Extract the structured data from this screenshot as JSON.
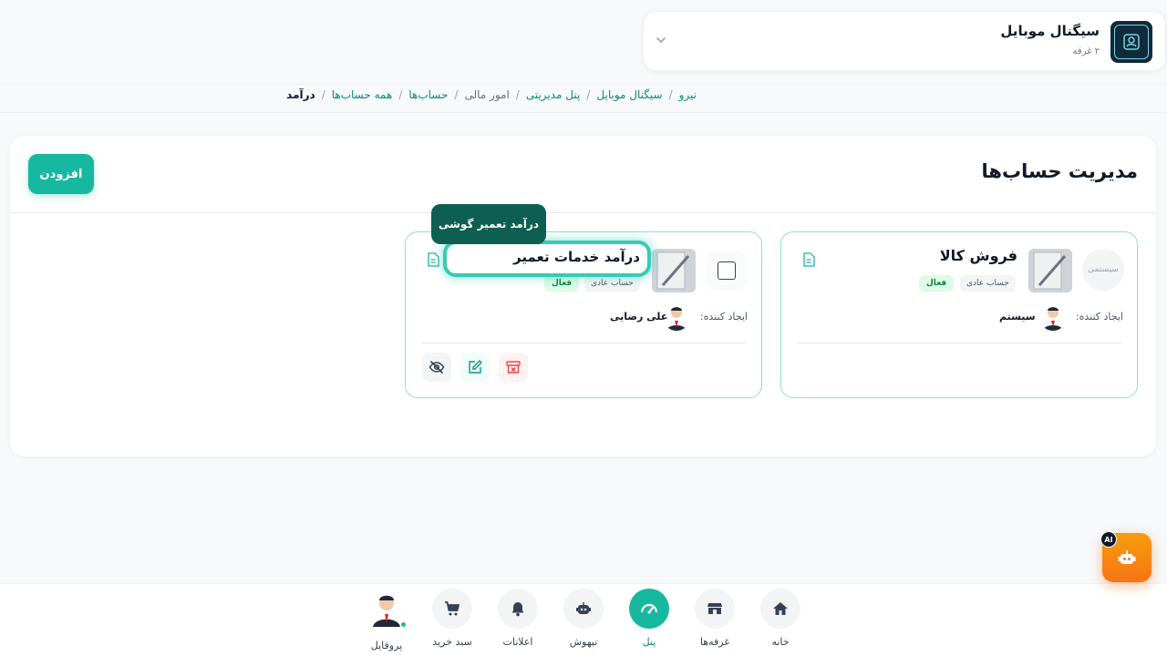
{
  "store": {
    "name": "سیگنال موبایل",
    "subtitle": "۲ غرفه"
  },
  "breadcrumb": [
    {
      "label": "نیرو",
      "kind": "link"
    },
    {
      "label": "سیگنال موبایل",
      "kind": "link"
    },
    {
      "label": "پنل مدیریتی",
      "kind": "link"
    },
    {
      "label": "امور مالی",
      "kind": "muted"
    },
    {
      "label": "حساب‌ها",
      "kind": "link"
    },
    {
      "label": "همه حساب‌ها",
      "kind": "link"
    },
    {
      "label": "درآمد",
      "kind": "current"
    }
  ],
  "page": {
    "title": "مدیریت حساب‌ها",
    "add_label": "افزودن"
  },
  "cards": [
    {
      "system_label": "سیستمی",
      "name": "فروش کالا",
      "type": "حساب عادی",
      "status": "فعال",
      "creator_label": "ایجاد کننده:",
      "creator_name": "سیستم"
    },
    {
      "name": "درآمد خدمات تعمیر",
      "type": "حساب عادی",
      "status": "فعال",
      "creator_label": "ایجاد کننده:",
      "creator_name": "علی رضایی"
    }
  ],
  "tooltip": "درآمد تعمیر گوشی",
  "nav": [
    {
      "label": "خانه",
      "icon": "home-icon"
    },
    {
      "label": "غرفه‌ها",
      "icon": "store-icon"
    },
    {
      "label": "پنل",
      "icon": "dashboard-icon",
      "active": true
    },
    {
      "label": "نیهوش",
      "icon": "robot-icon"
    },
    {
      "label": "اعلانات",
      "icon": "bell-icon"
    },
    {
      "label": "سبد خرید",
      "icon": "cart-icon"
    },
    {
      "label": "پروفایل",
      "icon": "avatar"
    }
  ],
  "ai": {
    "badge": "AI"
  },
  "colors": {
    "accent": "#17b8a0",
    "accent_dark": "#0e5f52",
    "card_border": "#8ee0cf",
    "ai_orange": "#f97316"
  }
}
